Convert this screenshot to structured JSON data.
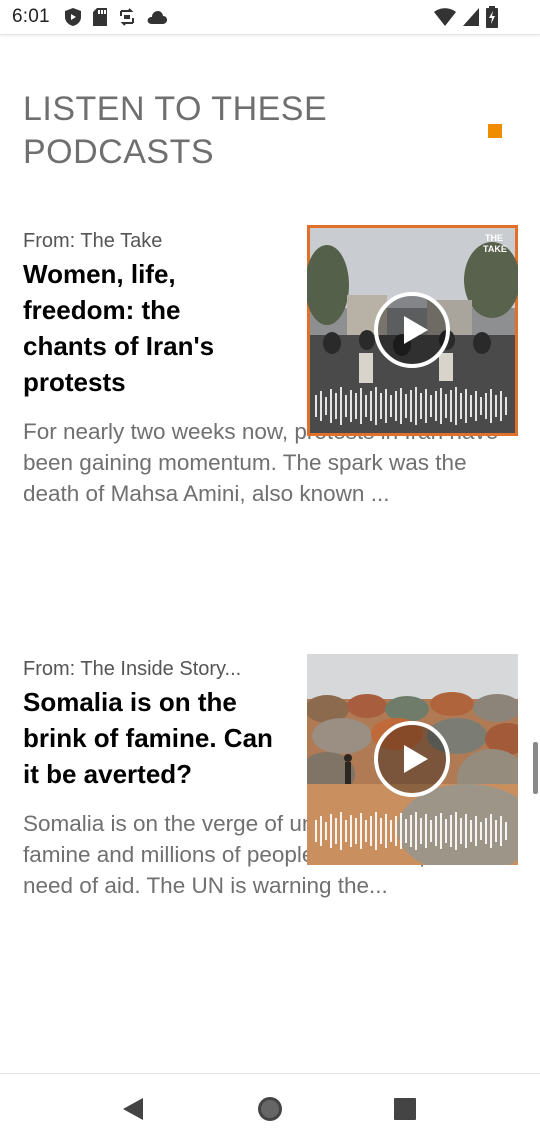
{
  "status_bar": {
    "time": "6:01",
    "left_icons": [
      "play-protect-icon",
      "sd-card-icon",
      "sync-icon",
      "cloud-icon"
    ],
    "right_icons": [
      "wifi-icon",
      "cell-signal-icon",
      "battery-icon"
    ]
  },
  "section": {
    "title": "LISTEN TO THESE PODCASTS",
    "accent_color": "#f08c00"
  },
  "podcasts": [
    {
      "source": "From: The Take",
      "title": "Women, life, freedom: the chants of Iran's protests",
      "description": "For nearly two weeks now, protests in Iran have been gaining momentum. The spark was the death of Mahsa Amini, also known ...",
      "thumbnail_border_color": "#e0702a",
      "play_icon": "play-icon",
      "thumb_badge": "THE TAKE"
    },
    {
      "source": "From: The Inside Story...",
      "title": "Somalia is on the brink of famine. Can it be averted?",
      "description": "Somalia is on the verge of unprecedented famine and millions of people are in desperate need of aid. The UN is warning the...",
      "play_icon": "play-icon"
    }
  ],
  "nav_bar": {
    "buttons": [
      "back-icon",
      "home-icon",
      "recents-icon"
    ]
  }
}
